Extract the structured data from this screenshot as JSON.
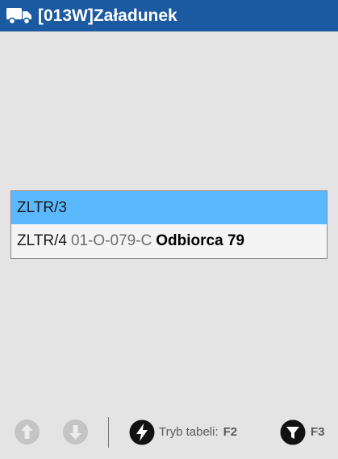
{
  "window": {
    "title": "[013W]Załadunek",
    "icon": "truck-icon",
    "title_bar_color": "#1b5aa0"
  },
  "list": {
    "selection_color": "#5ab9fd",
    "rows": [
      {
        "code": "ZLTR/3",
        "location": "",
        "client": "",
        "selected": true
      },
      {
        "code": "ZLTR/4",
        "location": "01-O-079-C",
        "client": "Odbiorca 79",
        "selected": false
      }
    ]
  },
  "toolbar": {
    "up_icon": "arrow-up-icon",
    "down_icon": "arrow-down-icon",
    "mode_icon": "lightning-icon",
    "mode_label": "Tryb tabeli:",
    "mode_key": "F2",
    "filter_icon": "filter-icon",
    "filter_key": "F3"
  }
}
